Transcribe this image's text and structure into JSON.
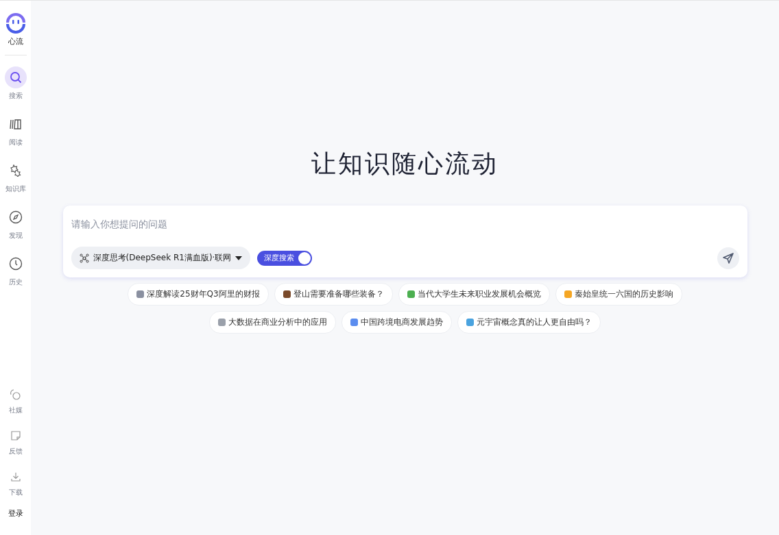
{
  "brand": {
    "name": "心流"
  },
  "sidebar": {
    "items": [
      {
        "kind": "search",
        "label": "搜索",
        "selected": true
      },
      {
        "kind": "read",
        "label": "阅读",
        "selected": false
      },
      {
        "kind": "knowledge",
        "label": "知识库",
        "selected": false
      },
      {
        "kind": "discover",
        "label": "发现",
        "selected": false
      },
      {
        "kind": "history",
        "label": "历史",
        "selected": false
      }
    ],
    "bottom_items": [
      {
        "kind": "social",
        "label": "社媒"
      },
      {
        "kind": "feedback",
        "label": "反馈"
      },
      {
        "kind": "download",
        "label": "下载"
      }
    ],
    "login": "登录"
  },
  "headline": "让知识随心流动",
  "query": {
    "placeholder": "请输入你想提问的问题",
    "model": "深度思考(DeepSeek R1满血版)·联网",
    "deep_search": {
      "label": "深度搜索",
      "on": true
    }
  },
  "suggestions": [
    [
      {
        "text": "深度解读25财年Q3阿里的财报",
        "color": "#8a90a0"
      },
      {
        "text": "登山需要准备哪些装备？",
        "color": "#7a4a2a"
      },
      {
        "text": "当代大学生未来职业发展机会概览",
        "color": "#4caf50"
      },
      {
        "text": "秦始皇统一六国的历史影响",
        "color": "#f5a623"
      }
    ],
    [
      {
        "text": "大数据在商业分析中的应用",
        "color": "#9aa0aa"
      },
      {
        "text": "中国跨境电商发展趋势",
        "color": "#5b8def"
      },
      {
        "text": "元宇宙概念真的让人更自由吗？",
        "color": "#4aa3df"
      }
    ]
  ]
}
